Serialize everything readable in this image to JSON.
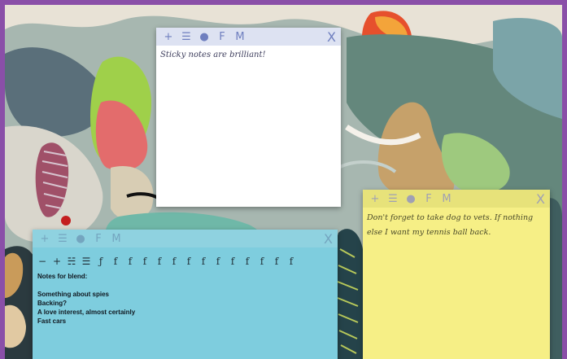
{
  "notes": {
    "white": {
      "toolbar": {
        "new": "+",
        "list": "☰",
        "palette": "●",
        "font": "F",
        "more": "M",
        "close": "X"
      },
      "text": "Sticky notes are brilliant!"
    },
    "yellow": {
      "toolbar": {
        "new": "+",
        "list": "☰",
        "palette": "●",
        "font": "F",
        "more": "M",
        "close": "X"
      },
      "text": "Don't forget to take dog to vets. If nothing else I want my tennis ball back."
    },
    "blue": {
      "toolbar": {
        "new": "+",
        "list": "☰",
        "palette": "●",
        "font": "F",
        "more": "M",
        "close": "X"
      },
      "format_buttons": [
        "−",
        "+",
        "☵",
        "☰",
        "ƒ",
        "f",
        "f",
        "f",
        "f",
        "f",
        "f",
        "f",
        "f",
        "f",
        "f",
        "f",
        "f",
        "f"
      ],
      "lines": [
        "Notes for blend:",
        "",
        "Something about spies",
        "Backing?",
        "A love interest, almost certainly",
        "Fast cars"
      ]
    }
  },
  "colors": {
    "white_note": "#ffffff",
    "yellow_note": "#f6ef86",
    "blue_note": "#7ecdde",
    "frame": "#8a4fa8"
  }
}
